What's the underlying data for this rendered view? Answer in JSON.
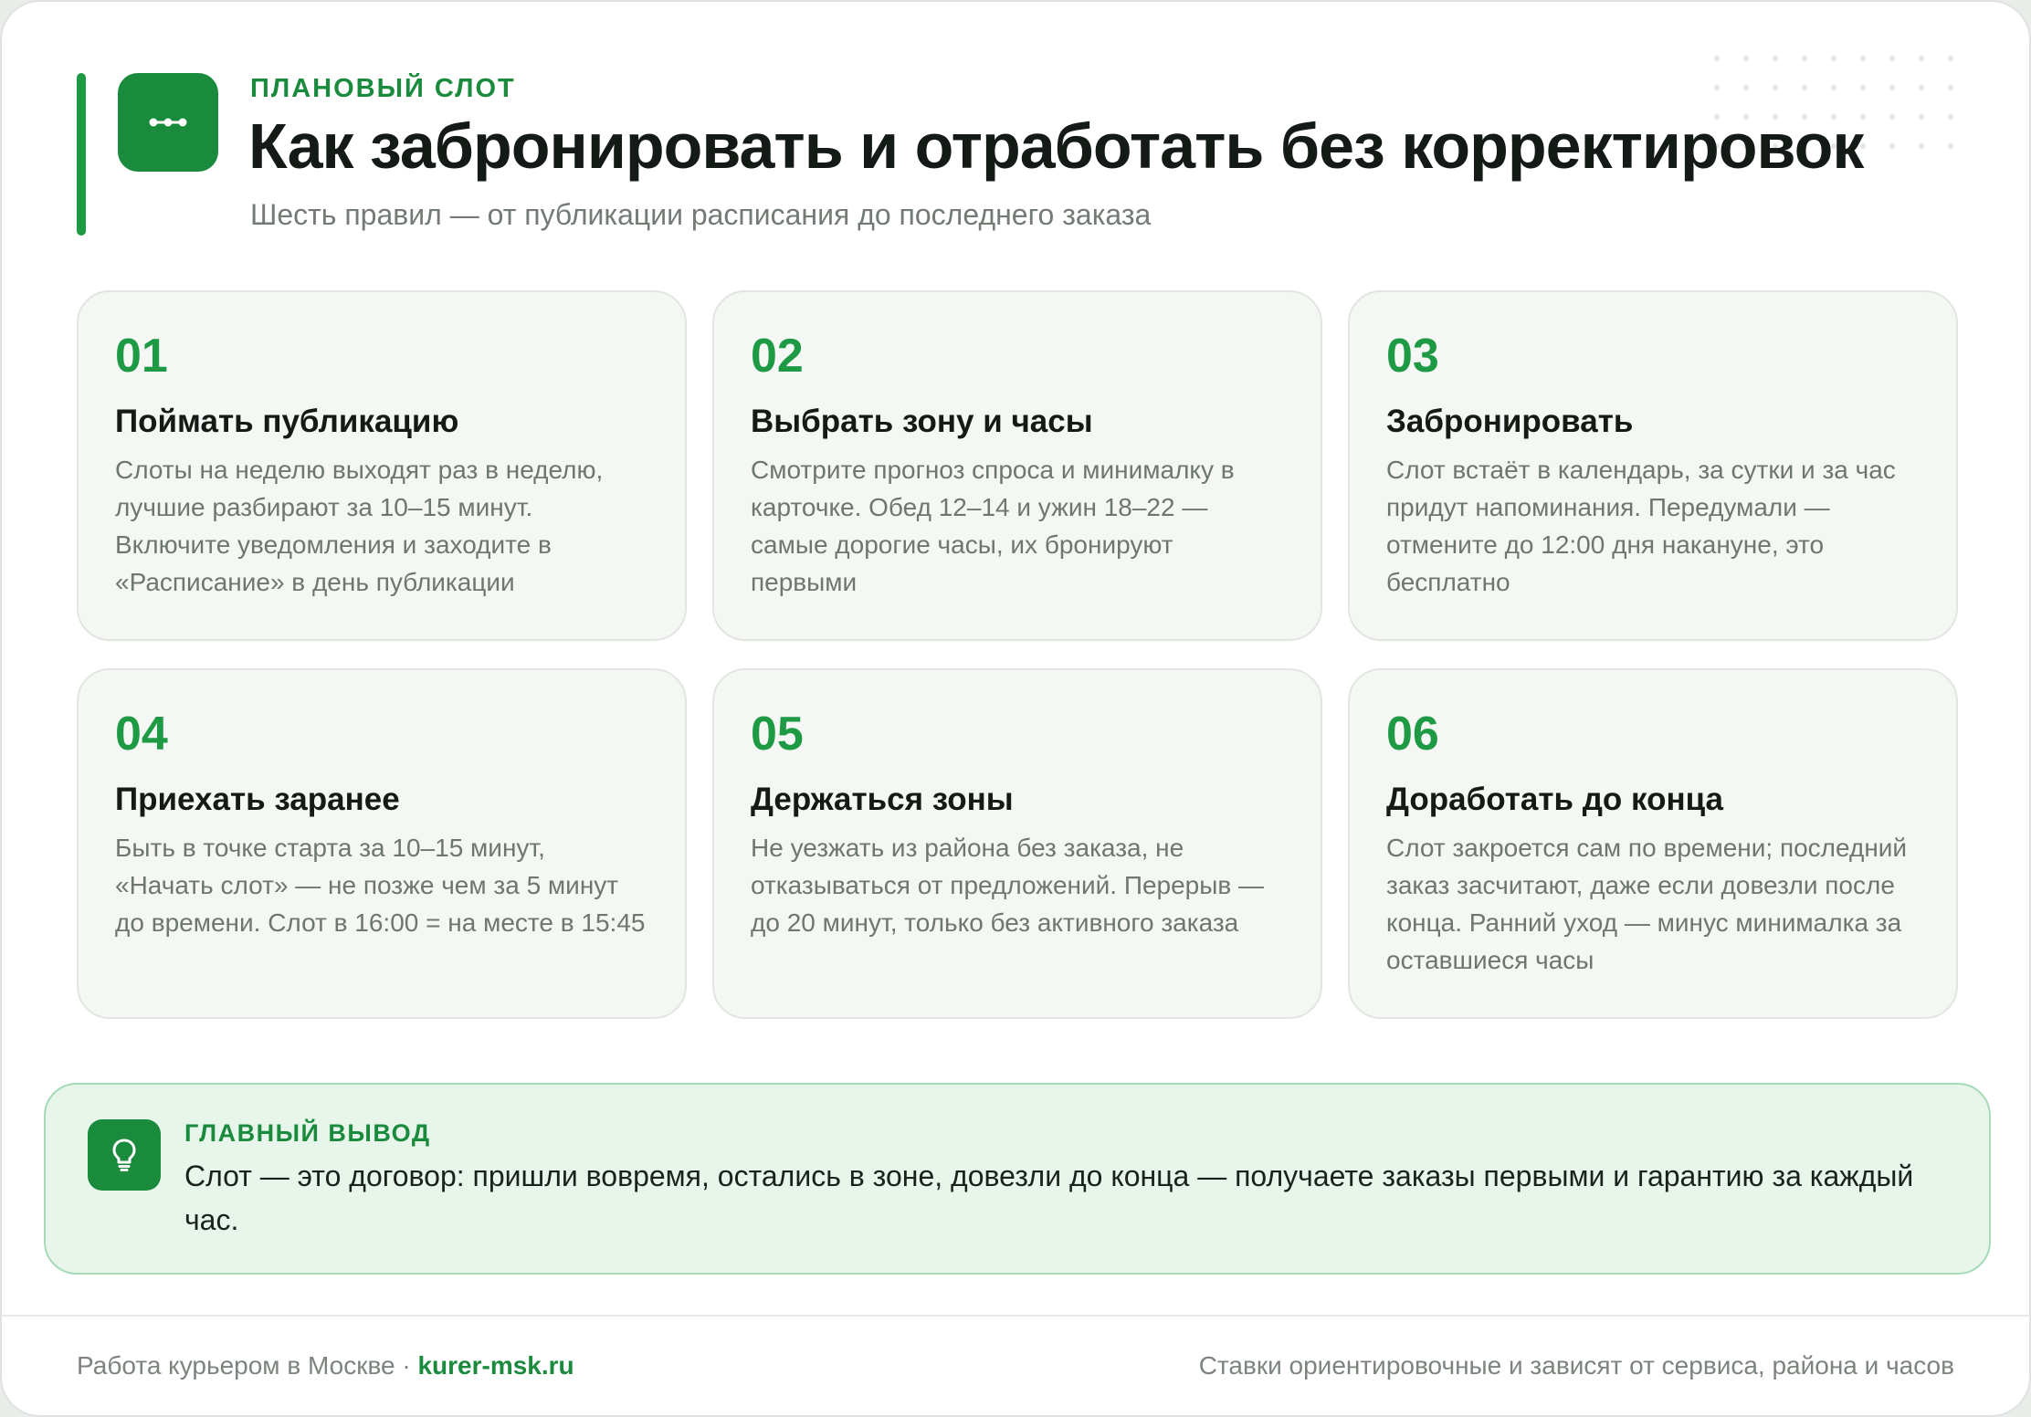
{
  "colors": {
    "brand_green": "#1a8a3d",
    "number_green": "#1e9a45",
    "title_text": "#141a16",
    "muted_text": "#6e776f",
    "card_background": "#f5f7f4",
    "takeaway_background": "#e7f5eb",
    "takeaway_border": "#a7dbb7"
  },
  "header": {
    "logo_icon": "route-dots-icon",
    "eyebrow": "ПЛАНОВЫЙ СЛОТ",
    "title": "Как забронировать и отработать без корректировок",
    "subtitle": "Шесть правил — от публикации расписания до последнего заказа"
  },
  "steps": [
    {
      "number": "01",
      "title": "Поймать публикацию",
      "text": "Слоты на неделю выходят раз в неделю, лучшие разбирают за 10–15 минут. Включите уведомления и заходите в «Расписание» в день публикации"
    },
    {
      "number": "02",
      "title": "Выбрать зону и часы",
      "text": "Смотрите прогноз спроса и минималку в карточке. Обед 12–14 и ужин 18–22 — самые дорогие часы, их бронируют первыми"
    },
    {
      "number": "03",
      "title": "Забронировать",
      "text": "Слот встаёт в календарь, за сутки и за час придут напоминания. Передумали — отмените до 12:00 дня накануне, это бесплатно"
    },
    {
      "number": "04",
      "title": "Приехать заранее",
      "text": "Быть в точке старта за 10–15 минут, «Начать слот» — не позже чем за 5 минут до времени. Слот в 16:00 = на месте в 15:45"
    },
    {
      "number": "05",
      "title": "Держаться зоны",
      "text": "Не уезжать из района без заказа, не отказываться от предложений. Перерыв — до 20 минут, только без активного заказа"
    },
    {
      "number": "06",
      "title": "Доработать до конца",
      "text": "Слот закроется сам по времени; последний заказ засчитают, даже если довезли после конца. Ранний уход — минус минималка за оставшиеся часы"
    }
  ],
  "takeaway": {
    "icon": "lightbulb-icon",
    "label": "ГЛАВНЫЙ ВЫВОД",
    "text": "Слот — это договор: пришли вовремя, остались в зоне, довезли до конца — получаете заказы первыми и гарантию за каждый час."
  },
  "footer": {
    "left_text": "Работа курьером в Москве · ",
    "site": "kurer-msk.ru",
    "right_text": "Ставки ориентировочные и зависят от сервиса, района и часов"
  }
}
